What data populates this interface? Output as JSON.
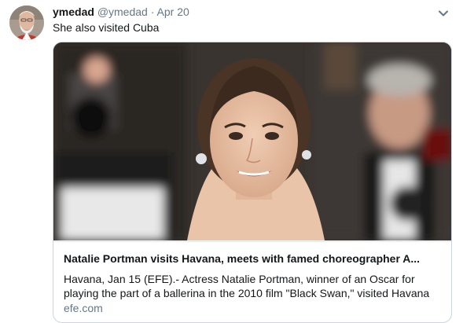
{
  "tweet": {
    "display_name": "ymedad",
    "handle": "@ymedad",
    "separator": "·",
    "date": "Apr 20",
    "text": "She also visited Cuba"
  },
  "card": {
    "title": "Natalie Portman visits Havana, meets with famed choreographer A...",
    "description": "Havana, Jan 15 (EFE).- Actress Natalie Portman, winner of an Oscar for playing the part of a ballerina in the 2010 film \"Black Swan,\" visited Havana",
    "domain": "efe.com"
  },
  "icons": {
    "menu": "chevron-down-icon"
  },
  "colors": {
    "name": "#14171a",
    "secondary_text": "#657786",
    "card_border": "#ccd6dd"
  }
}
